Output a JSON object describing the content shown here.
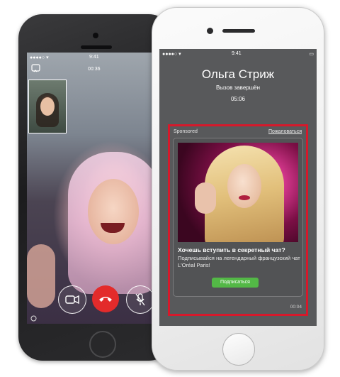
{
  "left_phone": {
    "status_time": "9:41",
    "call_timer": "00:36"
  },
  "right_phone": {
    "status_time": "9:41",
    "contact_name": "Ольга Стриж",
    "call_status": "Вызов завершён",
    "call_duration": "05:06",
    "ad": {
      "sponsored_label": "Sponsored",
      "report_link": "Пожаловаться",
      "heading": "Хочешь вступить в секретный чат?",
      "body": "Подписывайся на легендарный французский чат L'Oréal Paris!",
      "cta_label": "Подписаться",
      "timestamp": "00:04"
    }
  },
  "colors": {
    "end_call": "#e32b2b",
    "highlight_frame": "#d6192b",
    "cta_green": "#53b846",
    "screen_gray": "#58595b"
  }
}
